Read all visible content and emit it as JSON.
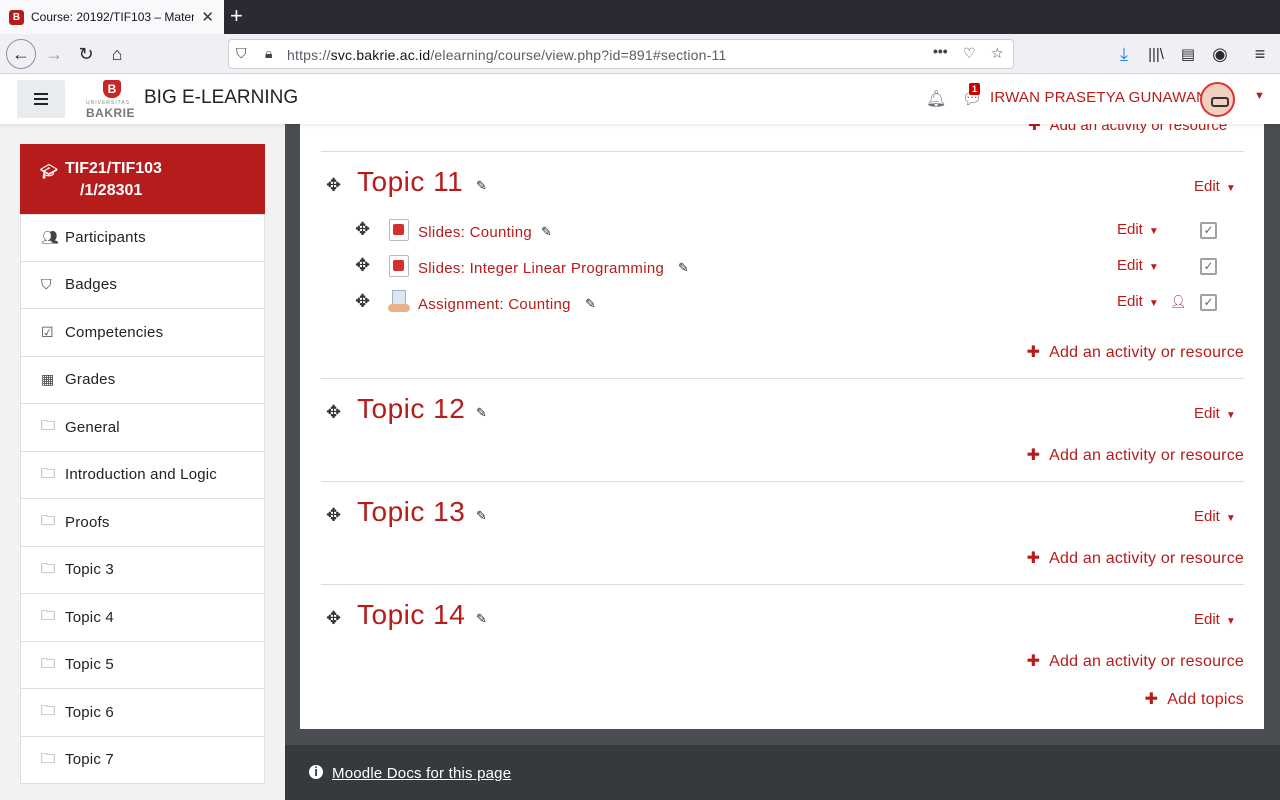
{
  "browser": {
    "tab_title": "Course: 20192/TIF103 – Mater",
    "tab_favicon": "B",
    "url_host": "svc.bakrie.ac.id",
    "url_prefix": "https://",
    "url_path": "/elearning/course/view.php?id=891#section-11",
    "icons": [
      "back-arrow-icon",
      "forward-arrow-icon",
      "reload-icon",
      "home-icon",
      "shield-icon",
      "lock-icon",
      "more-icon",
      "pocket-icon",
      "star-icon",
      "download-icon",
      "library-icon",
      "sidebar-icon",
      "account-icon",
      "menu-icon"
    ]
  },
  "header": {
    "site_name": "BIG E-LEARNING",
    "logo_sub": "UNIVERSITAS",
    "logo_main": "BAKRIE",
    "logo_letter": "B",
    "message_count": "1",
    "user_name": "IRWAN PRASETYA GUNAWAN"
  },
  "drawer": {
    "course_line1": "TIF21/TIF103",
    "course_line2": "/1/28301",
    "items": [
      {
        "label": "Participants",
        "icon": "users-icon"
      },
      {
        "label": "Badges",
        "icon": "shield-icon"
      },
      {
        "label": "Competencies",
        "icon": "checkbox-icon"
      },
      {
        "label": "Grades",
        "icon": "table-icon"
      },
      {
        "label": "General",
        "icon": "folder-icon"
      },
      {
        "label": "Introduction and Logic",
        "icon": "folder-icon"
      },
      {
        "label": "Proofs",
        "icon": "folder-icon"
      },
      {
        "label": "Topic 3",
        "icon": "folder-icon"
      },
      {
        "label": "Topic 4",
        "icon": "folder-icon"
      },
      {
        "label": "Topic 5",
        "icon": "folder-icon"
      },
      {
        "label": "Topic 6",
        "icon": "folder-icon"
      },
      {
        "label": "Topic 7",
        "icon": "folder-icon"
      }
    ]
  },
  "main": {
    "add_activity_label": "Add an activity or resource",
    "edit_label": "Edit",
    "add_topics_label": "Add topics",
    "topics": [
      {
        "name": "Topic 11",
        "activities": [
          {
            "label": "Slides: Counting",
            "type": "pdf-icon"
          },
          {
            "label": "Slides: Integer Linear Programming",
            "type": "pdf-icon"
          },
          {
            "label": "Assignment: Counting",
            "type": "assignment-icon"
          }
        ]
      },
      {
        "name": "Topic 12",
        "activities": []
      },
      {
        "name": "Topic 13",
        "activities": []
      },
      {
        "name": "Topic 14",
        "activities": []
      }
    ]
  },
  "footer": {
    "docs_link": "Moodle Docs for this page"
  },
  "colors": {
    "brand": "#b71c1c",
    "footer": "#373a3c",
    "drawer_bg": "#f2f2f2",
    "main_bg": "#4a4d51"
  }
}
